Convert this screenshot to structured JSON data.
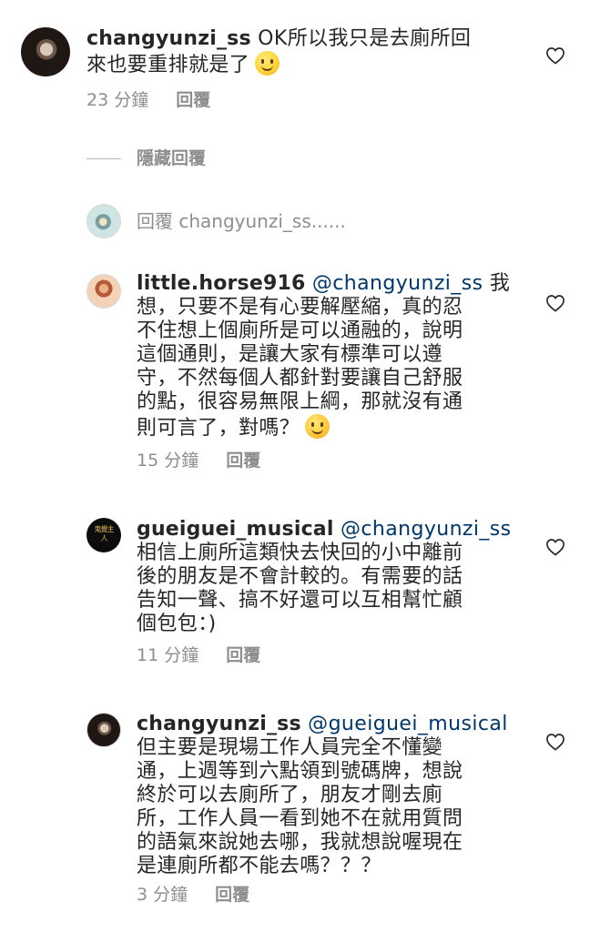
{
  "comments": [
    {
      "username": "changyunzi_ss",
      "mention": "",
      "lines_first": " OK所以我只是去廁所回",
      "lines_rest": "來也要重排就是了",
      "time": "23 分鐘",
      "reply": "回覆"
    },
    {
      "username": "little.horse916",
      "mention": "@changyunzi_ss",
      "text_first": " 我",
      "lines": [
        "想，只要不是有心要解壓縮，真的忍",
        "不住想上個廁所是可以通融的，說明",
        "這個通則，是讓大家有標準可以遵",
        "守，不然每個人都針對要讓自己舒服",
        "的點，很容易無限上綱，那就沒有通",
        "則可言了，對嗎？"
      ],
      "time": "15 分鐘",
      "reply": "回覆"
    },
    {
      "username": "gueiguei_musical",
      "mention": "@changyunzi_ss",
      "lines": [
        "相信上廁所這類快去快回的小中離前",
        "後的朋友是不會計較的。有需要的話",
        "告知一聲、搞不好還可以互相幫忙顧",
        "個包包：)"
      ],
      "time": "11 分鐘",
      "reply": "回覆"
    },
    {
      "username": "changyunzi_ss",
      "mention": "@gueiguei_musical",
      "lines": [
        "但主要是現場工作人員完全不懂變",
        "通，上週等到六點領到號碼牌，想說",
        "終於可以去廁所了，朋友才剛去廁",
        "所，工作人員一看到她不在就用質問",
        "的語氣來說她去哪，我就想說喔現在",
        "是連廁所都不能去嗎？？？"
      ],
      "time": "3 分鐘",
      "reply": "回覆"
    }
  ],
  "hidden_replies_label": "隱藏回覆",
  "reply_input_placeholder": "回覆 changyunzi_ss......",
  "avatar_gueiguei_text": "鬼覺主人",
  "icons": {
    "like": "heart-outline-icon",
    "emoji_smile": "slightly-smiling-face-emoji",
    "emoji_blush": "smiling-face-with-smiling-eyes-emoji"
  },
  "colors": {
    "text": "#262626",
    "meta": "#8e8e8e",
    "mention": "#00376b"
  }
}
